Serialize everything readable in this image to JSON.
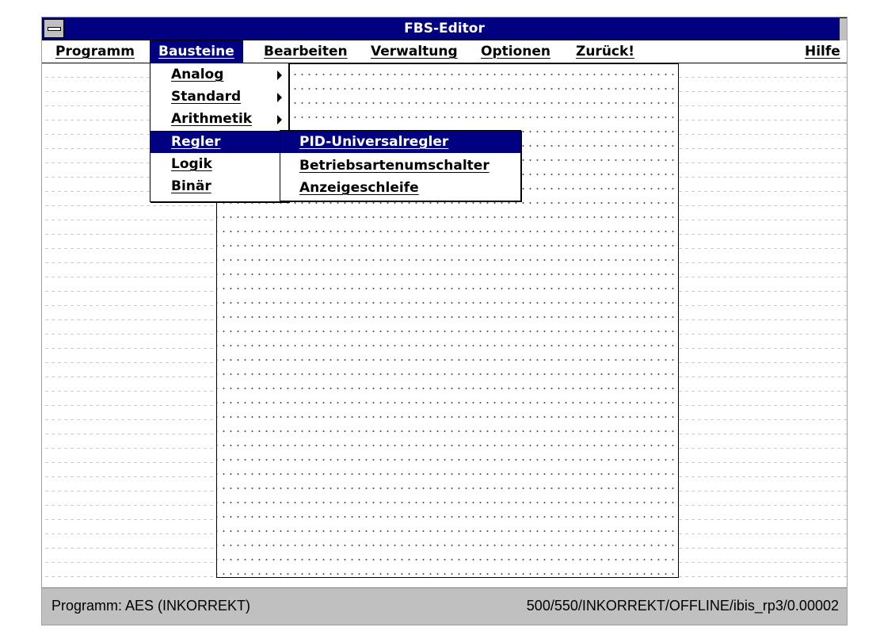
{
  "window": {
    "title": "FBS-Editor",
    "system_menu_icon": "system-menu-icon"
  },
  "menubar": {
    "items": [
      {
        "label": "Programm"
      },
      {
        "label": "Bausteine",
        "active": true
      },
      {
        "label": "Bearbeiten"
      },
      {
        "label": "Verwaltung"
      },
      {
        "label": "Optionen"
      },
      {
        "label": "Zurück!"
      },
      {
        "label": "Hilfe"
      }
    ]
  },
  "bausteine_menu": {
    "items": [
      {
        "label": "Analog",
        "has_submenu": true
      },
      {
        "label": "Standard",
        "has_submenu": true
      },
      {
        "label": "Arithmetik",
        "has_submenu": true
      },
      {
        "label": "Regler",
        "has_submenu": true,
        "active": true
      },
      {
        "label": "Logik",
        "has_submenu": false
      },
      {
        "label": "Binär",
        "has_submenu": false
      }
    ]
  },
  "regler_submenu": {
    "items": [
      {
        "label": "PID-Universalregler",
        "active": true
      },
      {
        "label": "Betriebsartenumschalter"
      },
      {
        "label": "Anzeigeschleife"
      }
    ]
  },
  "statusbar": {
    "left": "Programm: AES (INKORREKT)",
    "right": "500/550/INKORREKT/OFFLINE/ibis_rp3/0.00002"
  },
  "colors": {
    "titlebar": "#000080",
    "highlight": "#000080",
    "statusbar": "#c0c0c0"
  }
}
